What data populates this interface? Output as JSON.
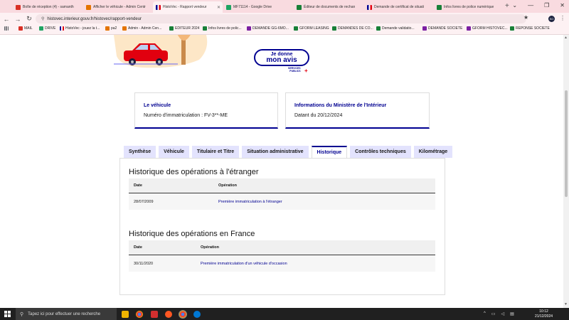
{
  "browser": {
    "tabs": [
      {
        "title": "Boîte de réception (4) - samanth",
        "favicon_color": "#d93025"
      },
      {
        "title": "Afficher le véhicule - Admin Centr",
        "favicon_color": "#e37400"
      },
      {
        "title": "HistoVec - Rapport vendeur",
        "favicon_color": "#000091",
        "active": true
      },
      {
        "title": "MF71114 - Google Drive",
        "favicon_color": "#1fa463"
      },
      {
        "title": "Éditeur de documents de rechan",
        "favicon_color": "#188038"
      },
      {
        "title": "Demande de certificat de situati",
        "favicon_color": "#000091"
      },
      {
        "title": "Infos livres de police numérique",
        "favicon_color": "#188038"
      }
    ],
    "new_tab": "+",
    "window_controls": [
      "⌄",
      "—",
      "❐",
      "✕"
    ],
    "url": "histovec.interieur.gouv.fr/histovec/rapport-vendeur",
    "profile_initials": "SO",
    "bookmarks": [
      {
        "label": "",
        "color": "#5f6368"
      },
      {
        "label": "MAIL",
        "color": "#d93025"
      },
      {
        "label": "DRIVE",
        "color": "#1fa463"
      },
      {
        "label": "HistoVec - jouez la t...",
        "color": "#000091"
      },
      {
        "label": "pa2",
        "color": "#e37400"
      },
      {
        "label": "Admin - Admin Cen...",
        "color": "#e37400"
      },
      {
        "label": "EDITEUR 2024",
        "color": "#188038"
      },
      {
        "label": "Infos livres de polic...",
        "color": "#188038"
      },
      {
        "label": "DEMANDE GG-6MO...",
        "color": "#7b1fa2"
      },
      {
        "label": "GFORM LEASING",
        "color": "#188038"
      },
      {
        "label": "DEMANDES DE CO...",
        "color": "#188038"
      },
      {
        "label": "Demande validatio...",
        "color": "#188038"
      },
      {
        "label": "DEMANDE SOCIETE",
        "color": "#7b1fa2"
      },
      {
        "label": "GFORM HISTOVEC...",
        "color": "#7b1fa2"
      },
      {
        "label": "REPONSE SOCIETE",
        "color": "#188038"
      }
    ]
  },
  "page": {
    "avis": {
      "line1": "Je donne",
      "line2": "mon avis",
      "logo_line1": "SERVICES",
      "logo_line2": "PUBLICS",
      "logo_plus": "+"
    },
    "cards": [
      {
        "title": "Le véhicule",
        "text": "Numéro d'immatriculation : FV-3**-ME"
      },
      {
        "title": "Informations du Ministère de l'Intérieur",
        "text": "Datant du 20/12/2024"
      }
    ],
    "tabs": [
      "Synthèse",
      "Véhicule",
      "Titulaire et Titre",
      "Situation administrative",
      "Historique",
      "Contrôles techniques",
      "Kilométrage"
    ],
    "active_tab": "Historique",
    "foreign": {
      "title": "Historique des opérations à l'étranger",
      "headers": [
        "Date",
        "Opération"
      ],
      "rows": [
        {
          "date": "28/07/2009",
          "operation": "Première immatriculation à l'étranger"
        }
      ]
    },
    "france": {
      "title": "Historique des opérations en France",
      "headers": [
        "Date",
        "Opération"
      ],
      "rows": [
        {
          "date": "30/11/2020",
          "operation": "Première immatriculation d'un véhicule d'occasion"
        }
      ]
    }
  },
  "taskbar": {
    "search_placeholder": "Tapez ici pour effectuer une recherche",
    "time": "10:12",
    "date": "21/12/2024"
  },
  "colors": {
    "dsfr_blue": "#000091",
    "tab_inactive": "#e3e3fd",
    "tabstrip": "#f9dbe0"
  }
}
